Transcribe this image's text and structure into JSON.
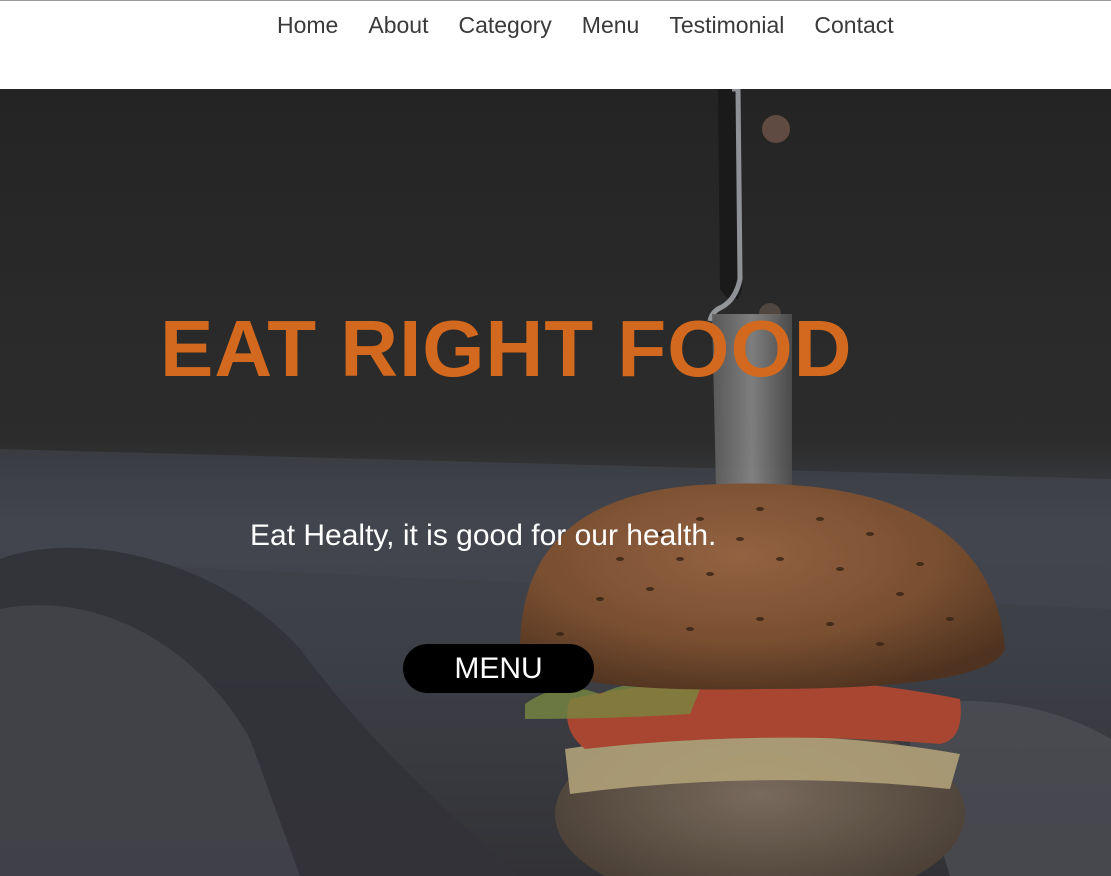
{
  "nav": {
    "items": [
      {
        "label": "Home"
      },
      {
        "label": "About"
      },
      {
        "label": "Category"
      },
      {
        "label": "Menu"
      },
      {
        "label": "Testimonial"
      },
      {
        "label": "Contact"
      }
    ]
  },
  "hero": {
    "background_image": "burger-with-knife-photo",
    "title": "EAT RIGHT FOOD",
    "subtitle": "Eat Healty, it is good for our health.",
    "button_label": "MENU"
  },
  "colors": {
    "accent": "#d2691e",
    "nav_text": "#3a3a3a",
    "button_bg": "#000000",
    "button_text": "#ffffff"
  }
}
